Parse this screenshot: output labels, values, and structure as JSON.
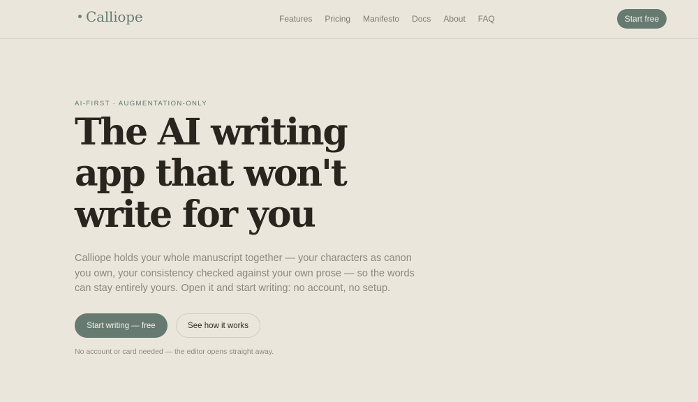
{
  "header": {
    "logo": "Calliope",
    "nav": [
      "Features",
      "Pricing",
      "Manifesto",
      "Docs",
      "About",
      "FAQ"
    ],
    "cta": "Start free"
  },
  "hero": {
    "eyebrow": "AI-FIRST · AUGMENTATION-ONLY",
    "headline": "The AI writing app that won't write for you",
    "lede": "Calliope holds your whole manuscript together — your characters as canon you own, your consistency checked against your own prose — so the words can stay entirely yours. Open it and start writing: no account, no setup.",
    "primary_cta": "Start writing — free",
    "secondary_cta": "See how it works",
    "note": "No account or card needed — the editor opens straight away."
  },
  "colors": {
    "background": "#ebe6dc",
    "accent": "#667a71",
    "heading": "#28251f",
    "muted": "#8b877e"
  }
}
